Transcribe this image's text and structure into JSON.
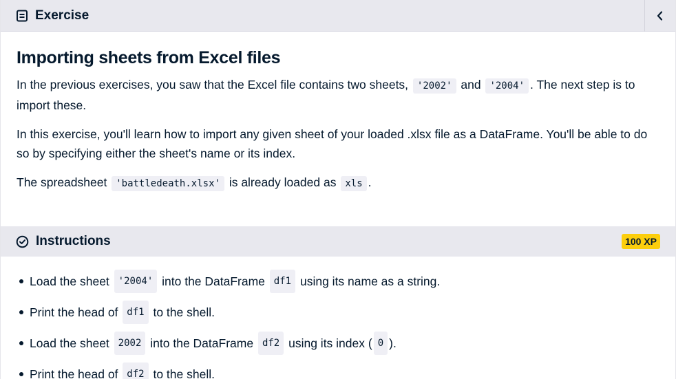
{
  "header": {
    "title": "Exercise"
  },
  "exercise": {
    "title": "Importing sheets from Excel files",
    "p1": {
      "t1": "In the previous exercises, you saw that the Excel file contains two sheets,",
      "c1": "'2002'",
      "t2": "and",
      "c2": "'2004'",
      "t3": ". The next step is to import these."
    },
    "p2": "In this exercise, you'll learn how to import any given sheet of your loaded .xlsx file as a DataFrame. You'll be able to do so by specifying either the sheet's name or its index.",
    "p3": {
      "t1": "The spreadsheet",
      "c1": "'battledeath.xlsx'",
      "t2": "is already loaded as",
      "c2": "xls",
      "t3": "."
    }
  },
  "instructions": {
    "title": "Instructions",
    "xp": "100 XP",
    "items": [
      {
        "t1": "Load the sheet",
        "c1": "'2004'",
        "t2": "into the DataFrame",
        "c2": "df1",
        "t3": "using its name as a string."
      },
      {
        "t1": "Print the head of",
        "c1": "df1",
        "t2": "to the shell."
      },
      {
        "t1": "Load the sheet",
        "c1": "2002",
        "t2": "into the DataFrame",
        "c2": "df2",
        "t3": "using its index (",
        "c3": "0",
        "t4": ")."
      },
      {
        "t1": "Print the head of",
        "c1": "df2",
        "t2": "to the shell."
      }
    ]
  },
  "icons": {
    "header": "document-icon",
    "collapse": "chevron-left-icon",
    "instructions": "check-circle-icon"
  },
  "colors": {
    "header_bg": "#e8e8ee",
    "text": "#05192d",
    "xp_badge": "#fcce0d",
    "code_bg": "#efeff5"
  }
}
